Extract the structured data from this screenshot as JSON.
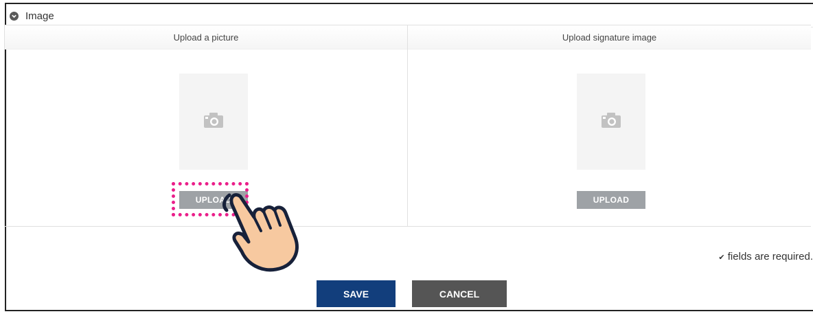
{
  "section": {
    "title": "Image",
    "icon": "chevron-down-icon"
  },
  "panels": [
    {
      "title": "Upload a picture",
      "button_label": "UPLOAD",
      "placeholder_icon": "camera-icon"
    },
    {
      "title": "Upload signature image",
      "button_label": "UPLOAD",
      "placeholder_icon": "camera-icon"
    }
  ],
  "required_note": {
    "mark": "✔",
    "text": "fields are required."
  },
  "actions": {
    "save_label": "SAVE",
    "cancel_label": "CANCEL"
  },
  "colors": {
    "save": "#123e7c",
    "cancel": "#555555",
    "upload": "#9ea2a6",
    "highlight": "#ea1f8a",
    "hand_fill": "#f7c9a0"
  }
}
